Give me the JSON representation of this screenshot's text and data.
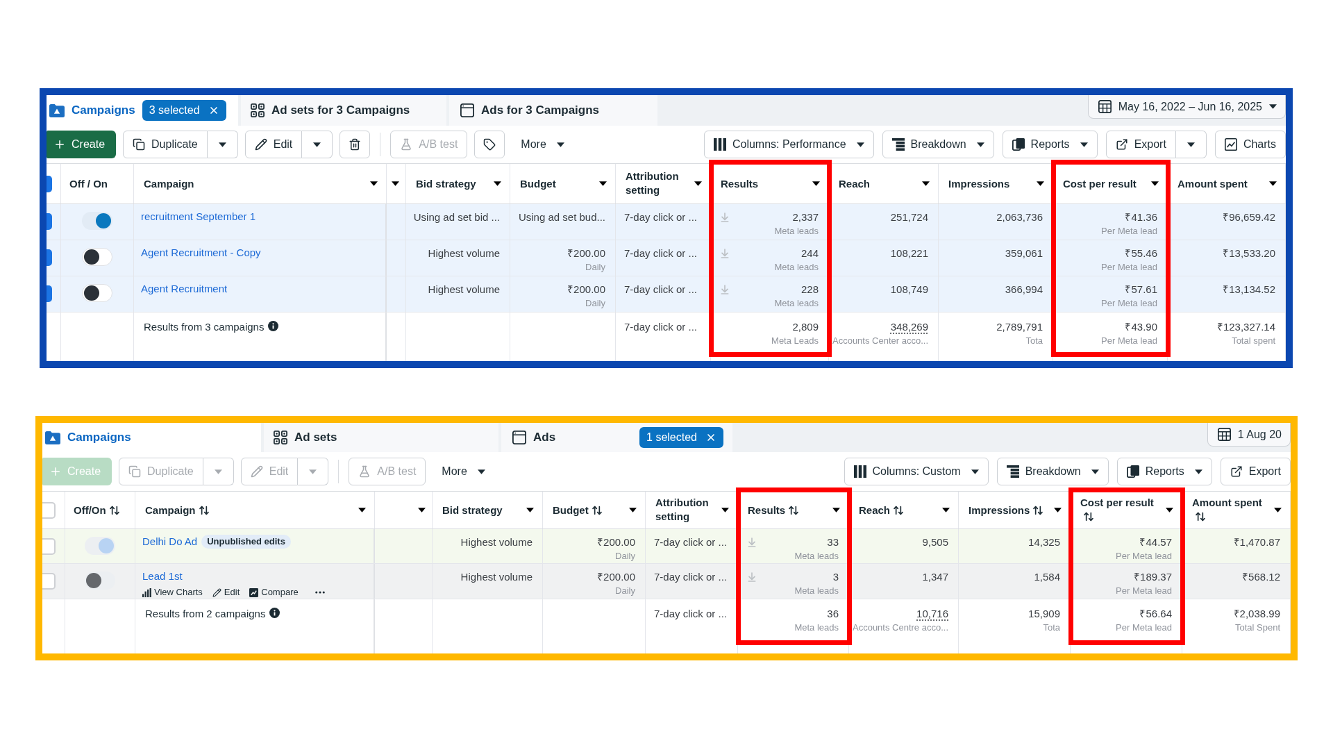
{
  "panels": [
    {
      "color": "#0b47b0",
      "tabs": [
        {
          "kind": "campaigns",
          "label": "Campaigns",
          "selected": true,
          "badge": "3 selected"
        },
        {
          "kind": "adsets",
          "label": "Ad sets for 3 Campaigns",
          "selected": false
        },
        {
          "kind": "ads",
          "label": "Ads for 3 Campaigns",
          "selected": false
        }
      ],
      "date_range": {
        "label": "May 16, 2022 – Jun 16, 2025",
        "dropdown": true
      },
      "toolbar": {
        "left": [
          {
            "kind": "create",
            "label": "Create",
            "disabled": false,
            "menu": false,
            "split": false
          },
          {
            "kind": "duplicate",
            "label": "Duplicate",
            "disabled": false,
            "menu": false,
            "split": true
          },
          {
            "kind": "edit",
            "label": "Edit",
            "disabled": false,
            "menu": false,
            "split": true
          },
          {
            "kind": "delete",
            "disabled": false,
            "menu": false,
            "split": false
          },
          {
            "kind": "test",
            "label": "A/B test",
            "disabled": true,
            "menu": false,
            "split": false
          },
          {
            "kind": "tag",
            "disabled": false,
            "menu": false,
            "split": false
          },
          {
            "kind": "more",
            "label": "More",
            "disabled": false,
            "menu": true,
            "split": false
          }
        ],
        "right": [
          {
            "kind": "columns",
            "label": "Columns: Performance",
            "disabled": false,
            "menu": true,
            "split": false
          },
          {
            "kind": "breakdown",
            "label": "Breakdown",
            "disabled": false,
            "menu": true,
            "split": false
          },
          {
            "kind": "reports",
            "label": "Reports",
            "disabled": false,
            "menu": true,
            "split": false
          },
          {
            "kind": "export",
            "label": "Export",
            "disabled": false,
            "menu": false,
            "split": true
          },
          {
            "kind": "charts",
            "label": "Charts",
            "disabled": false,
            "menu": false,
            "split": false
          }
        ]
      },
      "table": {
        "select_all": {
          "checked": true
        },
        "toggle_column": {
          "label": "Off / On",
          "sortable": false
        },
        "name_column": {
          "label": "Campaign",
          "sortable": false
        },
        "columns": [
          {
            "label": "Bid strategy",
            "sortable": false,
            "highlighted": false
          },
          {
            "label": "Budget",
            "sortable": false,
            "highlighted": false
          },
          {
            "label": "Attribution setting",
            "sortable": false,
            "highlighted": false
          },
          {
            "label": "Results",
            "sortable": false,
            "highlighted": true
          },
          {
            "label": "Reach",
            "sortable": false,
            "highlighted": false
          },
          {
            "label": "Impressions",
            "sortable": false,
            "highlighted": false
          },
          {
            "label": "Cost per result",
            "sortable": false,
            "highlighted": true
          },
          {
            "label": "Amount spent",
            "sortable": false,
            "highlighted": false
          }
        ],
        "rows": [
          {
            "checked": true,
            "on": true,
            "name": "recruitment September 1",
            "cells": [
              {
                "value": "Using ad set bid ..."
              },
              {
                "value": "Using ad set bud..."
              },
              {
                "value": "7-day click or ..."
              },
              {
                "value": "2,337",
                "note": "Meta leads"
              },
              {
                "value": "251,724"
              },
              {
                "value": "2,063,736"
              },
              {
                "value": "₹41.36",
                "note": "Per Meta lead"
              },
              {
                "value": "₹96,659.42"
              }
            ]
          },
          {
            "checked": true,
            "on": false,
            "name": "Agent Recruitment - Copy",
            "cells": [
              {
                "value": "Highest volume"
              },
              {
                "value": "₹200.00",
                "note": "Daily"
              },
              {
                "value": "7-day click or ..."
              },
              {
                "value": "244",
                "note": "Meta leads"
              },
              {
                "value": "108,221"
              },
              {
                "value": "359,061"
              },
              {
                "value": "₹55.46",
                "note": "Per Meta lead"
              },
              {
                "value": "₹13,533.20"
              }
            ]
          },
          {
            "checked": true,
            "on": false,
            "name": "Agent Recruitment",
            "cells": [
              {
                "value": "Highest volume"
              },
              {
                "value": "₹200.00",
                "note": "Daily"
              },
              {
                "value": "7-day click or ..."
              },
              {
                "value": "228",
                "note": "Meta leads"
              },
              {
                "value": "108,749"
              },
              {
                "value": "366,994"
              },
              {
                "value": "₹57.61",
                "note": "Per Meta lead"
              },
              {
                "value": "₹13,134.52"
              }
            ]
          }
        ],
        "summary": {
          "label": "Results from 3 campaigns",
          "cells": [
            {
              "value": "7-day click or ..."
            },
            {
              "value": "2,809",
              "note": "Meta Leads"
            },
            {
              "value": "348,269",
              "note": "Accounts Center acco..."
            },
            {
              "value": "2,789,791",
              "note": "Tota"
            },
            {
              "value": "₹43.90",
              "note": "Per Meta lead"
            },
            {
              "value": "₹123,327.14",
              "note": "Total spent"
            }
          ]
        }
      }
    },
    {
      "color": "#ffb800",
      "tabs": [
        {
          "kind": "campaigns",
          "label": "Campaigns",
          "selected": true
        },
        {
          "kind": "adsets",
          "label": "Ad sets",
          "selected": false
        },
        {
          "kind": "ads",
          "label": "Ads",
          "selected": false,
          "badge": "1 selected"
        }
      ],
      "date_range": {
        "label": "1 Aug 20",
        "dropdown": false
      },
      "toolbar": {
        "left": [
          {
            "kind": "create",
            "label": "Create",
            "disabled": true,
            "menu": false,
            "split": false
          },
          {
            "kind": "duplicate",
            "label": "Duplicate",
            "disabled": true,
            "menu": false,
            "split": true
          },
          {
            "kind": "edit",
            "label": "Edit",
            "disabled": true,
            "menu": false,
            "split": true
          },
          {
            "kind": "test",
            "label": "A/B test",
            "disabled": true,
            "menu": false,
            "split": false
          },
          {
            "kind": "more",
            "label": "More",
            "disabled": false,
            "menu": true,
            "split": false
          }
        ],
        "right": [
          {
            "kind": "columns",
            "label": "Columns: Custom",
            "disabled": false,
            "menu": true,
            "split": false
          },
          {
            "kind": "breakdown",
            "label": "Breakdown",
            "disabled": false,
            "menu": true,
            "split": false
          },
          {
            "kind": "reports",
            "label": "Reports",
            "disabled": false,
            "menu": true,
            "split": false
          },
          {
            "kind": "export",
            "label": "Export",
            "disabled": false,
            "menu": false,
            "split": false
          }
        ]
      },
      "table": {
        "select_all": {
          "checked": false
        },
        "toggle_column": {
          "label": "Off/On",
          "sortable": true
        },
        "name_column": {
          "label": "Campaign",
          "sortable": true
        },
        "columns": [
          {
            "label": "Bid strategy",
            "sortable": false,
            "highlighted": false
          },
          {
            "label": "Budget",
            "sortable": true,
            "highlighted": false
          },
          {
            "label": "Attribution setting",
            "sortable": false,
            "highlighted": false
          },
          {
            "label": "Results",
            "sortable": true,
            "highlighted": true
          },
          {
            "label": "Reach",
            "sortable": true,
            "highlighted": false
          },
          {
            "label": "Impressions",
            "sortable": true,
            "highlighted": false
          },
          {
            "label": "Cost per result",
            "sortable": true,
            "highlighted": true
          },
          {
            "label": "Amount spent",
            "sortable": true,
            "highlighted": false
          }
        ],
        "rows": [
          {
            "checked": false,
            "on": true,
            "name": "Delhi Do Ad",
            "badge": "Unpublished edits",
            "cells": [
              {
                "value": "Highest volume"
              },
              {
                "value": "₹200.00",
                "note": "Daily"
              },
              {
                "value": "7-day click or ..."
              },
              {
                "value": "33",
                "note": "Meta leads"
              },
              {
                "value": "9,505"
              },
              {
                "value": "14,325"
              },
              {
                "value": "₹44.57",
                "note": "Per Meta lead"
              },
              {
                "value": "₹1,470.87"
              }
            ]
          },
          {
            "checked": false,
            "on": false,
            "name": "Lead 1st",
            "actions": [
              {
                "kind": "charts",
                "label": "View Charts"
              },
              {
                "kind": "edit",
                "label": "Edit"
              },
              {
                "kind": "compare",
                "label": "Compare"
              }
            ],
            "cells": [
              {
                "value": "Highest volume"
              },
              {
                "value": "₹200.00",
                "note": "Daily"
              },
              {
                "value": "7-day click or ..."
              },
              {
                "value": "3",
                "note": "Meta leads"
              },
              {
                "value": "1,347"
              },
              {
                "value": "1,584"
              },
              {
                "value": "₹189.37",
                "note": "Per Meta lead"
              },
              {
                "value": "₹568.12"
              }
            ]
          }
        ],
        "summary": {
          "label": "Results from 2 campaigns",
          "cells": [
            {
              "value": "7-day click or ..."
            },
            {
              "value": "36",
              "note": "Meta leads"
            },
            {
              "value": "10,716",
              "note": "Accounts Centre acco..."
            },
            {
              "value": "15,909",
              "note": "Tota"
            },
            {
              "value": "₹56.64",
              "note": "Per Meta lead"
            },
            {
              "value": "₹2,038.99",
              "note": "Total Spent"
            }
          ]
        }
      }
    }
  ]
}
